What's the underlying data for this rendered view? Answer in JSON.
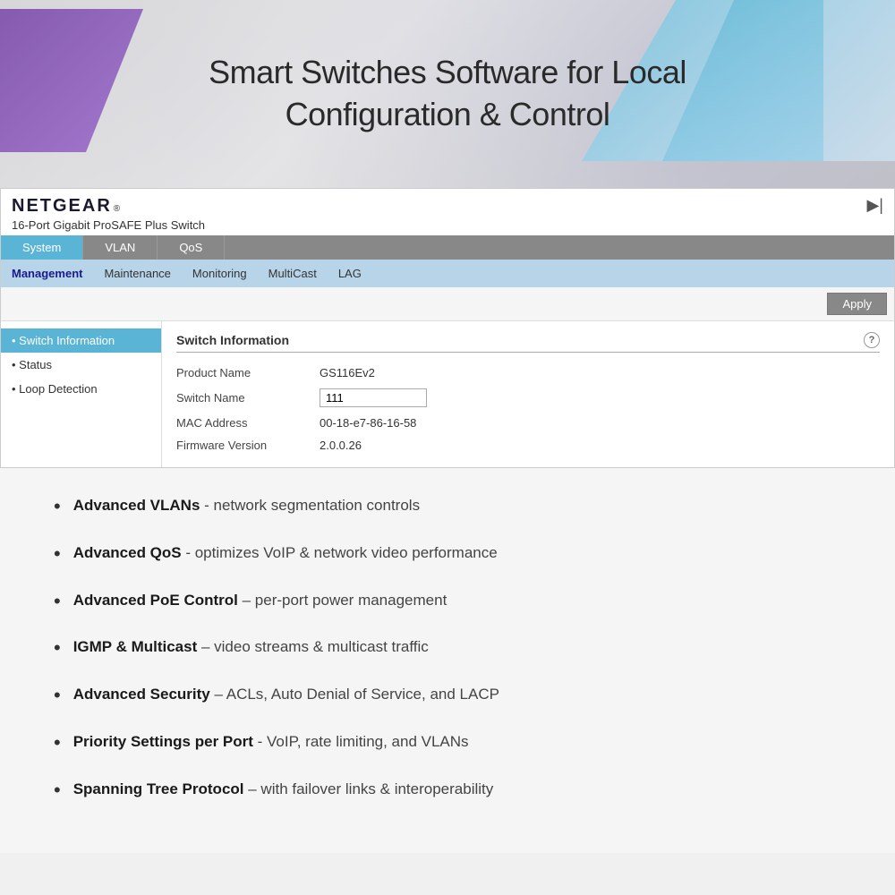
{
  "banner": {
    "title_line1": "Smart Switches Software for Local",
    "title_line2": "Configuration & Control"
  },
  "netgear": {
    "logo": "NETGEAR",
    "reg_symbol": "®",
    "device_name": "16-Port Gigabit ProSAFE Plus Switch"
  },
  "nav": {
    "tabs": [
      {
        "label": "System",
        "active": true
      },
      {
        "label": "VLAN",
        "active": false
      },
      {
        "label": "QoS",
        "active": false
      }
    ],
    "sub_items": [
      {
        "label": "Management",
        "active": true
      },
      {
        "label": "Maintenance",
        "active": false
      },
      {
        "label": "Monitoring",
        "active": false
      },
      {
        "label": "MultiCast",
        "active": false
      },
      {
        "label": "LAG",
        "active": false
      }
    ]
  },
  "toolbar": {
    "apply_label": "Apply"
  },
  "sidebar": {
    "items": [
      {
        "label": "Switch Information",
        "active": true
      },
      {
        "label": "Status",
        "active": false
      },
      {
        "label": "Loop Detection",
        "active": false
      }
    ]
  },
  "switch_info": {
    "section_title": "Switch Information",
    "fields": [
      {
        "label": "Product Name",
        "value": "GS116Ev2",
        "editable": false
      },
      {
        "label": "Switch Name",
        "value": "111",
        "editable": true
      },
      {
        "label": "MAC Address",
        "value": "00-18-e7-86-16-58",
        "editable": false
      },
      {
        "label": "Firmware Version",
        "value": "2.0.0.26",
        "editable": false
      }
    ]
  },
  "features": [
    {
      "bold": "Advanced VLANs",
      "normal": " - network segmentation controls"
    },
    {
      "bold": "Advanced QoS",
      "normal": " - optimizes VoIP & network video performance"
    },
    {
      "bold": "Advanced PoE Control",
      "normal": " – per-port power management"
    },
    {
      "bold": "IGMP & Multicast",
      "normal": " – video streams & multicast traffic"
    },
    {
      "bold": "Advanced Security",
      "normal": " – ACLs, Auto Denial of Service, and LACP"
    },
    {
      "bold": "Priority Settings per Port",
      "normal": " - VoIP, rate limiting, and VLANs"
    },
    {
      "bold": "Spanning Tree Protocol",
      "normal": " – with failover links & interoperability"
    }
  ]
}
